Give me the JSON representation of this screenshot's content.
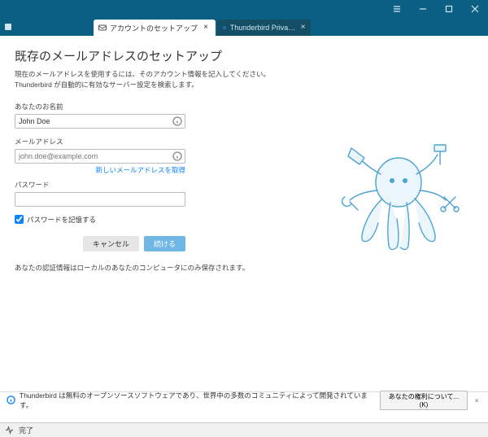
{
  "window": {
    "titlebar": {
      "menu": "≡",
      "minimize": "–",
      "maximize": "□",
      "close": "×"
    }
  },
  "tabs": {
    "active": {
      "label": "アカウントのセットアップ",
      "close": "×"
    },
    "inactive": {
      "label": "Thunderbird Privacy Notice — Mo...",
      "close": "×"
    }
  },
  "page": {
    "heading": "既存のメールアドレスのセットアップ",
    "sub1": "現在のメールアドレスを使用するには、そのアカウント情報を記入してください。",
    "sub2": "Thunderbird が自動的に有効なサーバー設定を検索します。"
  },
  "form": {
    "name_label": "あなたのお名前",
    "name_value": "John Doe",
    "email_label": "メールアドレス",
    "email_placeholder": "john.doe@example.com",
    "get_email_link": "新しいメールアドレスを取得",
    "password_label": "パスワード",
    "password_value": "",
    "remember_label": "パスワードを記憶する",
    "cancel_btn": "キャンセル",
    "continue_btn": "続ける"
  },
  "note": "あなたの認証情報はローカルのあなたのコンピュータにのみ保存されます。",
  "infobar": {
    "text": "Thunderbird は無料のオープンソースソフトウェアであり、世界中の多数のコミュニティによって開発されています。",
    "rights_btn": "あなたの権利について...(K)",
    "close": "×"
  },
  "statusbar": {
    "text": "完了"
  }
}
